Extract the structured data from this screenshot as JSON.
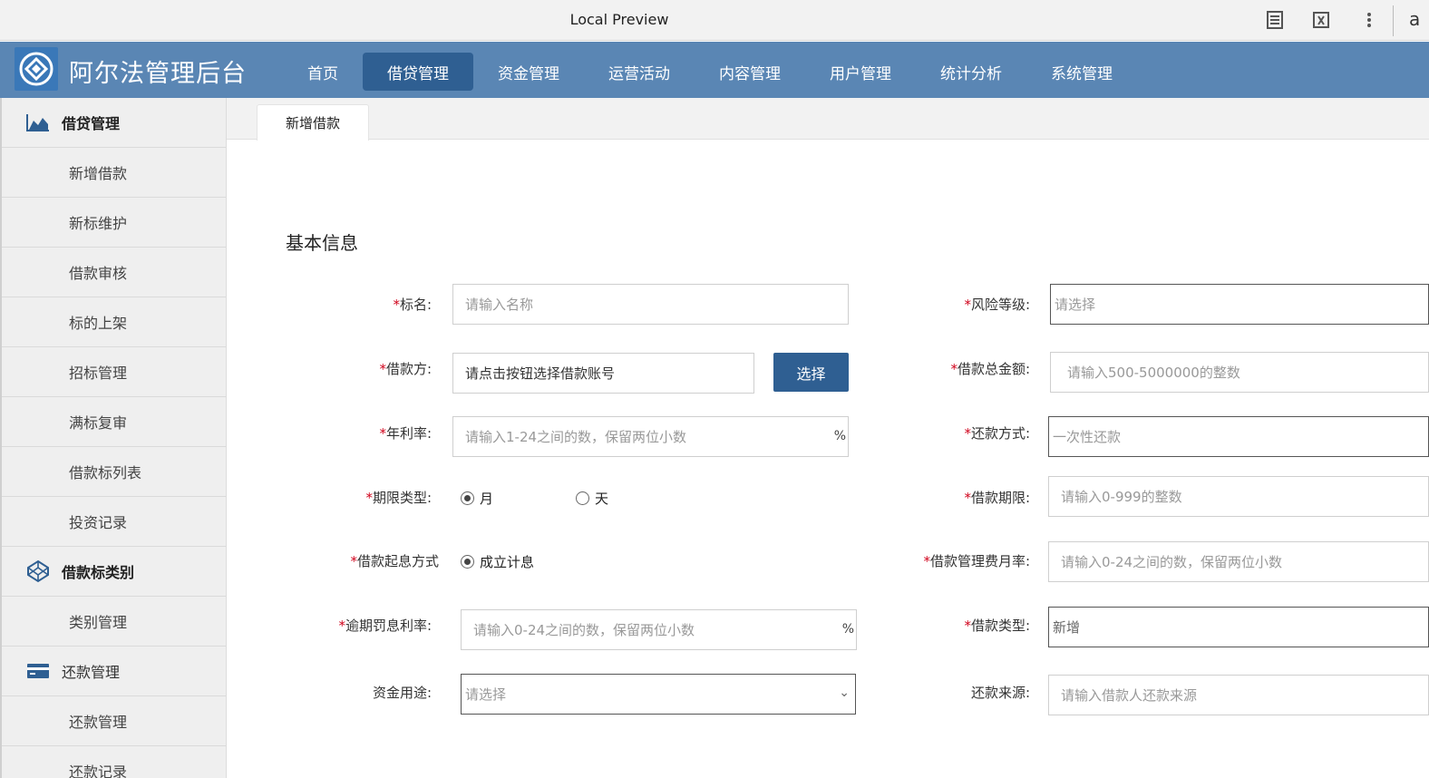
{
  "browser": {
    "title": "Local Preview",
    "icons": [
      "reader-icon",
      "translate-icon",
      "more-vert-icon"
    ],
    "edge_glyph": "a"
  },
  "header": {
    "app_title": "阿尔法管理后台",
    "nav": [
      {
        "label": "首页",
        "active": false
      },
      {
        "label": "借贷管理",
        "active": true
      },
      {
        "label": "资金管理",
        "active": false
      },
      {
        "label": "运营活动",
        "active": false
      },
      {
        "label": "内容管理",
        "active": false
      },
      {
        "label": "用户管理",
        "active": false
      },
      {
        "label": "统计分析",
        "active": false
      },
      {
        "label": "系统管理",
        "active": false
      }
    ],
    "bg_color": "#5a86b4",
    "active_color": "#2f5f92"
  },
  "sidebar": {
    "group1": {
      "label": "借贷管理",
      "icon": "area-chart-icon"
    },
    "group1_items": [
      "新增借款",
      "新标维护",
      "借款审核",
      "标的上架",
      "招标管理",
      "满标复审",
      "借款标列表",
      "投资记录"
    ],
    "group2": {
      "label": "借款标类别",
      "icon": "codepen-icon"
    },
    "group2_items": [
      "类别管理"
    ],
    "group3": {
      "label": "还款管理",
      "icon": "credit-card-icon"
    },
    "group3_items": [
      "还款管理",
      "还款记录"
    ]
  },
  "tabs": {
    "active": "新增借款"
  },
  "form": {
    "section_title": "基本信息",
    "required_mark": "*",
    "title_label": "标名:",
    "title_placeholder": "请输入名称",
    "borrower_label": "借款方:",
    "borrower_value": "请点击按钮选择借款账号",
    "select_button": "选择",
    "rate_label": "年利率:",
    "rate_placeholder": "请输入1-24之间的数，保留两位小数",
    "percent": "%",
    "term_type_label": "期限类型:",
    "term_type_options": [
      {
        "label": "月",
        "checked": true
      },
      {
        "label": "天",
        "checked": false
      }
    ],
    "interest_start_label": "借款起息方式",
    "interest_start_option": {
      "label": "成立计息",
      "checked": true
    },
    "overdue_rate_label": "逾期罚息利率:",
    "overdue_rate_placeholder": "请输入0-24之间的数，保留两位小数",
    "fund_usage_label": "资金用途:",
    "fund_usage_placeholder": "请选择",
    "risk_label": "风险等级:",
    "risk_placeholder": "请选择",
    "amount_label": "借款总金额:",
    "amount_placeholder": "请输入500-5000000的整数",
    "repay_method_label": "还款方式:",
    "repay_method_value": "一次性还款",
    "period_label": "借款期限:",
    "period_placeholder": "请输入0-999的整数",
    "mgmt_fee_label": "借款管理费月率:",
    "mgmt_fee_placeholder": "请输入0-24之间的数，保留两位小数",
    "loan_type_label": "借款类型:",
    "loan_type_value": "新增",
    "repay_source_label": "还款来源:",
    "repay_source_placeholder": "请输入借款人还款来源"
  }
}
